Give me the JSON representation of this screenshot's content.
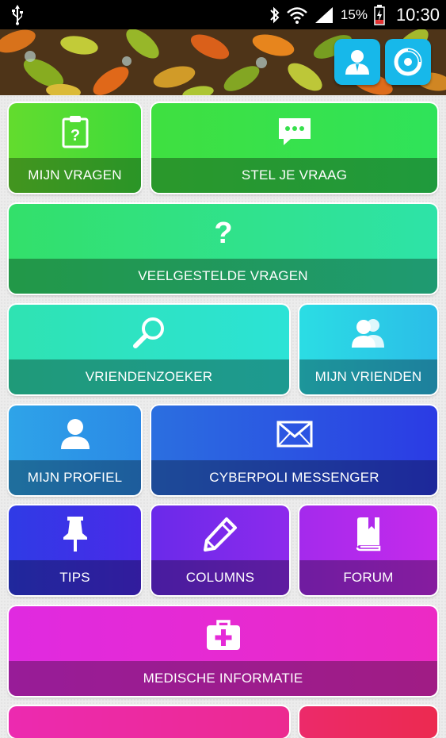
{
  "status_bar": {
    "battery_percent": "15%",
    "time": "10:30",
    "icons": [
      "usb-icon",
      "bluetooth-icon",
      "wifi-icon",
      "signal-icon",
      "battery-icon"
    ]
  },
  "header": {
    "buttons": [
      {
        "name": "profile-button",
        "icon": "user-icon"
      },
      {
        "name": "settings-button",
        "icon": "disc-icon"
      }
    ]
  },
  "tiles": {
    "mijn_vragen": {
      "label": "MIJN VRAGEN",
      "icon": "clipboard-question-icon"
    },
    "stel_je_vraag": {
      "label": "STEL JE VRAAG",
      "icon": "chat-bubble-icon"
    },
    "veelgestelde_vragen": {
      "label": "VEELGESTELDE VRAGEN",
      "icon": "question-mark-icon"
    },
    "vriendenzoeker": {
      "label": "VRIENDENZOEKER",
      "icon": "magnifier-icon"
    },
    "mijn_vrienden": {
      "label": "MIJN VRIENDEN",
      "icon": "friends-icon"
    },
    "mijn_profiel": {
      "label": "MIJN PROFIEL",
      "icon": "user-icon"
    },
    "cyberpoli_messenger": {
      "label": "CYBERPOLI MESSENGER",
      "icon": "envelope-icon"
    },
    "tips": {
      "label": "TIPS",
      "icon": "pushpin-icon"
    },
    "columns": {
      "label": "COLUMNS",
      "icon": "pencil-icon"
    },
    "forum": {
      "label": "FORUM",
      "icon": "book-icon"
    },
    "medische_informatie": {
      "label": "MEDISCHE INFORMATIE",
      "icon": "medical-kit-icon"
    }
  },
  "colors": {
    "header_button": "#17b8ea",
    "green": "#2fe36a",
    "teal": "#2ce3c8",
    "blue": "#2b6fe0",
    "purple": "#9a2cec",
    "magenta": "#ec2ad0"
  }
}
